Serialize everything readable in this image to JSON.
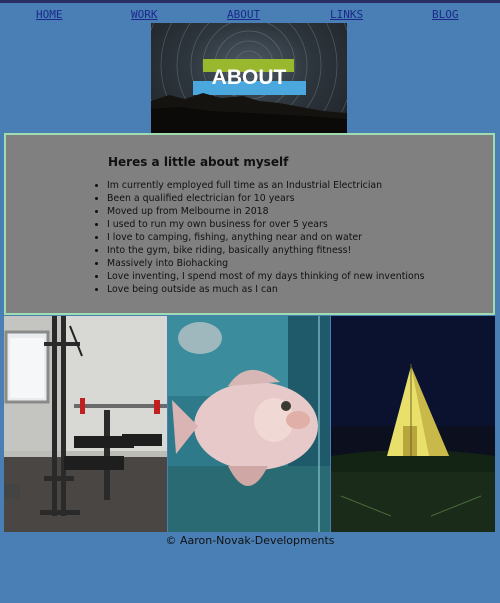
{
  "nav": {
    "items": [
      {
        "label": "HOME"
      },
      {
        "label": "WORK"
      },
      {
        "label": "ABOUT"
      },
      {
        "label": "LINKS"
      },
      {
        "label": "BLOG"
      }
    ]
  },
  "hero": {
    "heading": "ABOUT",
    "accent_green": "#9ab82e",
    "accent_blue": "#4aa8de"
  },
  "about": {
    "title": "Heres a little about myself",
    "items": [
      "Im currently employed full time as an Industrial Electrician",
      "Been a qualified electrician for 10 years",
      "Moved up from Melbourne in 2018",
      "I used to run my own business for over 5 years",
      "I love to camping, fishing, anything near and on water",
      "Into the gym, bike riding, basically anything fitness!",
      "Massively into Biohacking",
      "Love inventing, I spend most of my days thinking of new inventions",
      "Love being outside as much as I can"
    ]
  },
  "footer": {
    "symbol": "©",
    "text": "Aaron-Novak-Developments"
  },
  "colors": {
    "page_background": "#4a7fb5",
    "panel_background": "#808080",
    "panel_border": "#9fdcb0",
    "link": "#1a2a8a"
  }
}
